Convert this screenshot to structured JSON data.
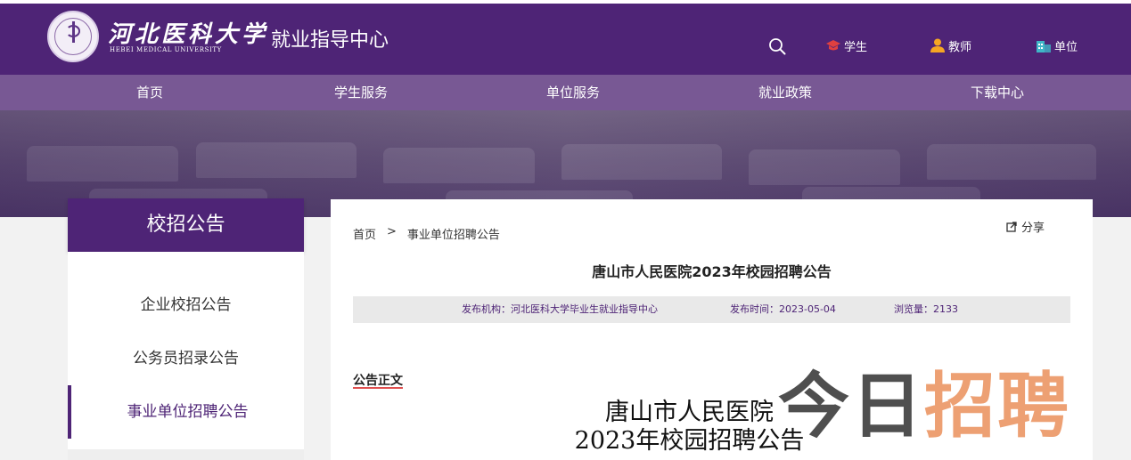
{
  "header": {
    "logo_cn": "河北医科大学",
    "logo_en": "HEBEI MEDICAL UNIVERSITY",
    "site_title": "就业指导中心",
    "user_links": [
      {
        "label": "学生",
        "icon": "graduation-cap-icon"
      },
      {
        "label": "教师",
        "icon": "teacher-icon"
      },
      {
        "label": "单位",
        "icon": "building-icon"
      }
    ]
  },
  "nav": {
    "items": [
      "首页",
      "学生服务",
      "单位服务",
      "就业政策",
      "下载中心"
    ]
  },
  "sidebar": {
    "title": "校招公告",
    "items": [
      "企业校招公告",
      "公务员招录公告",
      "事业单位招聘公告"
    ],
    "active_index": 2
  },
  "breadcrumb": {
    "home": "首页",
    "separator": ">",
    "current": "事业单位招聘公告"
  },
  "share_label": "分享",
  "article": {
    "title": "唐山市人民医院2023年校园招聘公告",
    "publisher": "发布机构：河北医科大学毕业生就业指导中心",
    "date": "发布时间：2023-05-04",
    "views": "浏览量：2133",
    "section_label": "公告正文",
    "body_line1": "唐山市人民医院",
    "body_line2": "2023年校园招聘公告"
  },
  "watermark": {
    "dark": "今日",
    "orange": "招聘"
  },
  "colors": {
    "brand_purple": "#4e2476",
    "nav_purple": "#6e4b8c",
    "icon_orange": "#f5a623",
    "icon_teal": "#3fb6c8",
    "icon_red": "#e04040"
  }
}
